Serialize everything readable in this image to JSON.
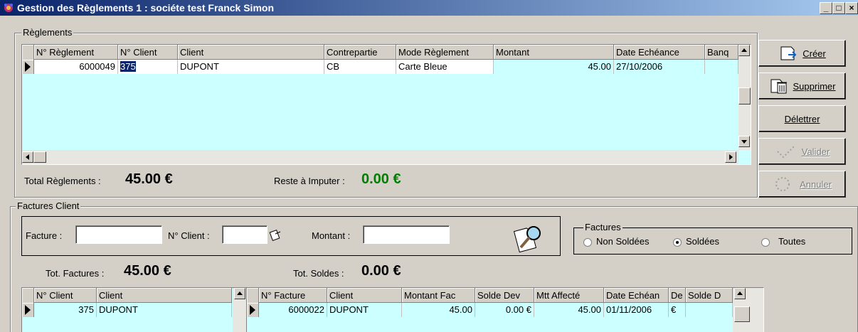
{
  "window": {
    "title": "Gestion des Règlements 1 : sociéte test Franck Simon",
    "minimize": "_",
    "maximize": "□",
    "close": "×"
  },
  "reglements": {
    "legend": "Règlements",
    "columns": [
      "N° Règlement",
      "N° Client",
      "Client",
      "Contrepartie",
      "Mode Règlement",
      "Montant",
      "Date Echéance",
      "Banq"
    ],
    "rows": [
      {
        "num": "6000049",
        "client_num": "375",
        "client": "DUPONT",
        "contrepartie": "CB",
        "mode": "Carte Bleue",
        "montant": "45.00",
        "date": "27/10/2006",
        "banque": ""
      }
    ],
    "total_label": "Total Règlements :",
    "total_value": "45.00 €",
    "reste_label": "Reste à Imputer :",
    "reste_value": "0.00 €"
  },
  "buttons": {
    "creer": "Créer",
    "supprimer": "Supprimer",
    "delettrer": "Délettrer",
    "valider": "Valider",
    "annuler": "Annuler"
  },
  "factures": {
    "legend": "Factures Client",
    "facture_label": "Facture :",
    "client_label": "N° Client :",
    "montant_label": "Montant :",
    "facture_value": "",
    "client_value": "",
    "montant_value": "",
    "filter_legend": "Factures",
    "filter_options": [
      "Non Soldées",
      "Soldées",
      "Toutes"
    ],
    "filter_selected": "Soldées",
    "tot_factures_label": "Tot. Factures :",
    "tot_factures_value": "45.00 €",
    "tot_soldes_label": "Tot. Soldes :",
    "tot_soldes_value": "0.00 €"
  },
  "clients_grid": {
    "columns": [
      "N° Client",
      "Client"
    ],
    "rows": [
      {
        "num": "375",
        "client": "DUPONT"
      }
    ]
  },
  "factures_grid": {
    "columns": [
      "N° Facture",
      "Client",
      "Montant Fac",
      "Solde Dev",
      "Mtt Affecté",
      "Date Echéan",
      "De",
      "Solde D"
    ],
    "rows": [
      {
        "num": "6000022",
        "client": "DUPONT",
        "montant": "45.00",
        "solde": "0.00 €",
        "affecte": "45.00",
        "date": "01/11/2006",
        "devise": "€",
        "solde_d": ""
      }
    ]
  },
  "colors": {
    "row_bg": "#ccffff",
    "reste_color": "#008000",
    "title_start": "#0a246a"
  }
}
